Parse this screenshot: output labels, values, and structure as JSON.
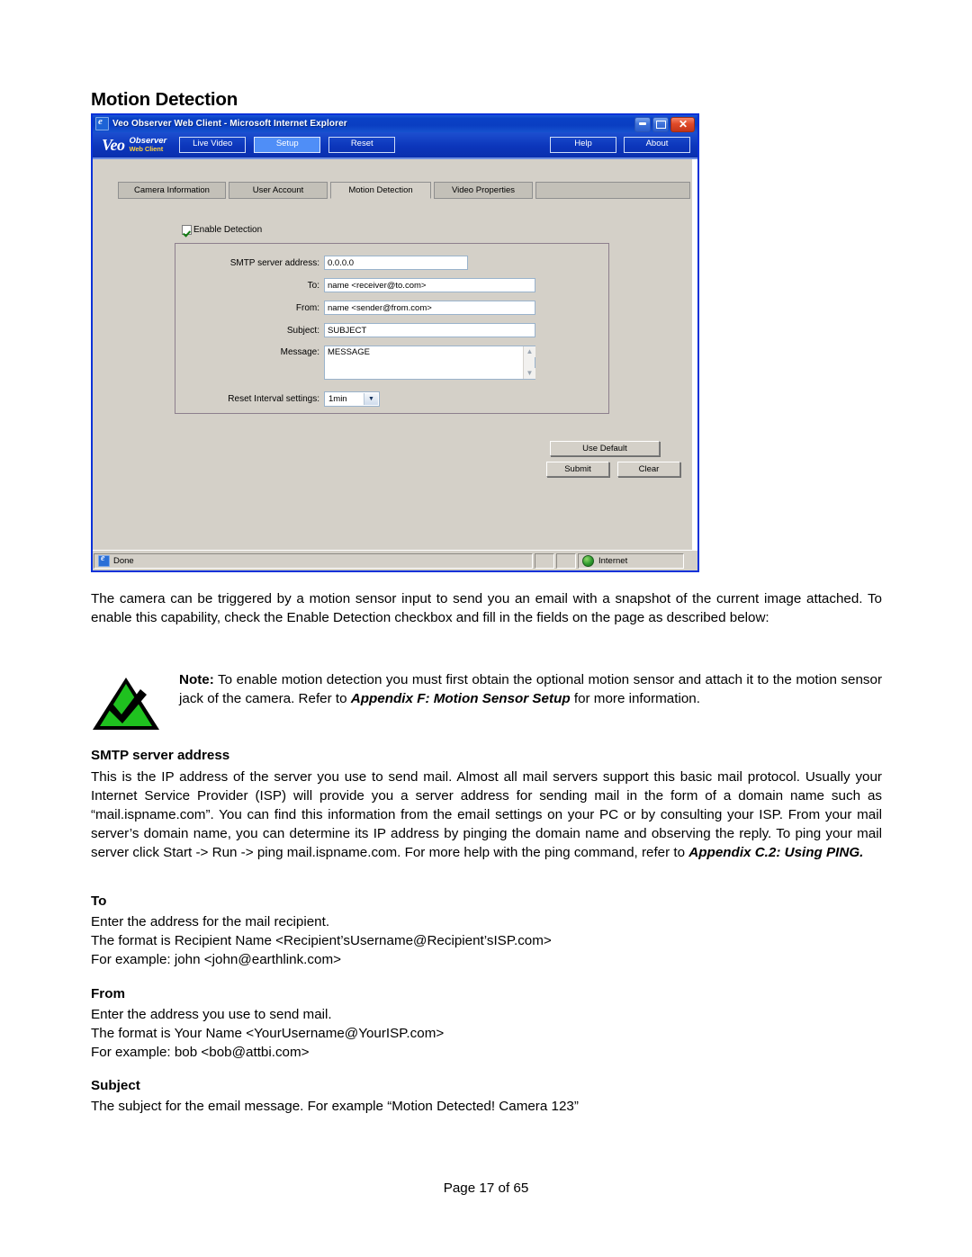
{
  "document": {
    "heading": "Motion Detection",
    "footer": "Page 17 of 65"
  },
  "browser": {
    "title": "Veo Observer Web Client - Microsoft Internet Explorer",
    "icons": {
      "app": "ie-icon",
      "minimize": "minimize-icon",
      "maximize": "maximize-icon",
      "close": "close-icon"
    },
    "window_buttons": {
      "minimize": "_",
      "maximize": "□",
      "close": "✕"
    },
    "logo": {
      "brand": "Veo",
      "product": "Observer",
      "subtitle": "Web Client"
    },
    "nav_left": [
      {
        "label": "Live Video",
        "active": false
      },
      {
        "label": "Setup",
        "active": true
      },
      {
        "label": "Reset",
        "active": false
      }
    ],
    "nav_right": [
      {
        "label": "Help"
      },
      {
        "label": "About"
      }
    ],
    "tabs": [
      {
        "label": "Camera Information",
        "active": false
      },
      {
        "label": "User Account",
        "active": false
      },
      {
        "label": "Motion Detection",
        "active": true
      },
      {
        "label": "Video Properties",
        "active": false
      }
    ],
    "form": {
      "enable_detection_label": "Enable Detection",
      "enable_detection_checked": true,
      "fields": [
        {
          "label": "SMTP server address:",
          "value": "0.0.0.0"
        },
        {
          "label": "To:",
          "value": "name <receiver@to.com>"
        },
        {
          "label": "From:",
          "value": "name <sender@from.com>"
        },
        {
          "label": "Subject:",
          "value": "SUBJECT"
        },
        {
          "label": "Message:",
          "value": "MESSAGE"
        }
      ],
      "reset_interval_label": "Reset Interval settings:",
      "reset_interval_value": "1min"
    },
    "buttons": {
      "use_default": "Use Default",
      "submit": "Submit",
      "clear": "Clear"
    },
    "statusbar": {
      "status": "Done",
      "zone": "Internet"
    },
    "colors": {
      "titlebar_blue": "#0a41c6",
      "toolbar_blue": "#0c36bb",
      "active_nav": "#4f8ef7",
      "window_face": "#d4d0c8",
      "logo_yellow": "#ffd23c"
    }
  },
  "content": {
    "intro": "The camera can be triggered by a motion sensor input to send you an email with a snapshot of the current image attached. To enable this capability, check the Enable Detection checkbox and fill in the fields on the page as described below:",
    "note": {
      "icon": "note-checkmark-icon",
      "label": "Note:",
      "text_before": " To enable motion detection you must first obtain the optional motion sensor and attach it to the motion sensor jack of the camera. Refer to ",
      "emphasis": "Appendix F: Motion Sensor Setup",
      "text_after": " for more information."
    },
    "sections": [
      {
        "heading": "SMTP server address",
        "body_before": "This is the IP address of the server you use to send mail. Almost all mail servers support this basic mail protocol. Usually your Internet Service Provider (ISP) will provide you a server address for sending mail in the form of a domain name such as “mail.ispname.com”. You can find this information from the email settings on your PC or by consulting your ISP.  From your mail server’s domain name, you can determine its IP address by pinging the domain name and observing the reply. To ping your mail server click Start -> Run -> ping mail.ispname.com.  For more help with the ping command, refer to ",
        "emphasis": "Appendix C.2: Using PING.",
        "body_after": ""
      },
      {
        "heading": "To",
        "lines": [
          "Enter the address for the mail recipient.",
          "The format is Recipient Name <Recipient’sUsername@Recipient’sISP.com>",
          "For example:  john <john@earthlink.com>"
        ]
      },
      {
        "heading": "From",
        "lines": [
          "Enter the address you use to send mail.",
          "The format is Your Name <YourUsername@YourISP.com>",
          "For example: bob <bob@attbi.com>"
        ]
      },
      {
        "heading": "Subject",
        "lines": [
          "The subject for the email message.  For example “Motion Detected! Camera 123”"
        ]
      }
    ]
  }
}
